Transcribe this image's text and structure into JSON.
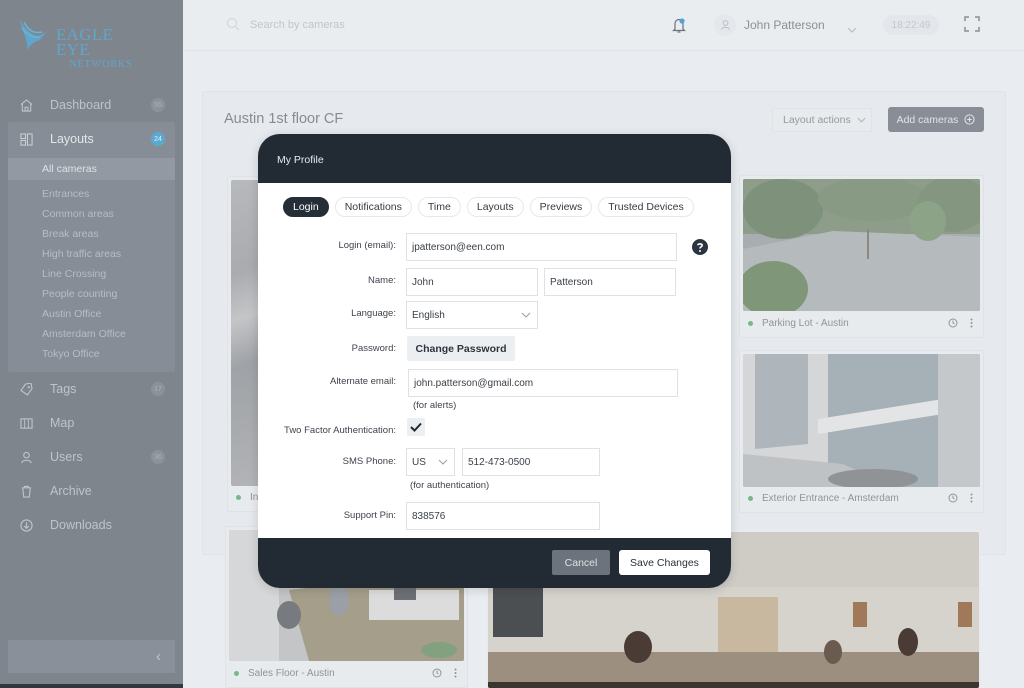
{
  "brand": {
    "name": "EAGLE EYE",
    "sub": "NETWORKS",
    "accent_color": "#5fa6cc"
  },
  "sidebar": {
    "items": [
      {
        "label": "Dashboard",
        "icon": "home-icon",
        "badge": "55"
      },
      {
        "label": "Layouts",
        "icon": "layouts-icon",
        "badge": "24"
      },
      {
        "label": "Tags",
        "icon": "tag-icon",
        "badge": "17"
      },
      {
        "label": "Map",
        "icon": "map-icon",
        "badge": ""
      },
      {
        "label": "Users",
        "icon": "user-icon",
        "badge": "36"
      },
      {
        "label": "Archive",
        "icon": "trash-icon",
        "badge": ""
      },
      {
        "label": "Downloads",
        "icon": "download-icon",
        "badge": ""
      }
    ],
    "layouts_sub": [
      "All cameras",
      "Entrances",
      "Common areas",
      "Break areas",
      "High traffic areas",
      "Line Crossing",
      "People counting",
      "Austin Office",
      "Amsterdam Office",
      "Tokyo Office"
    ],
    "collapse_icon": "‹"
  },
  "header": {
    "search_placeholder": "Search by cameras",
    "user_name": "John Patterson",
    "clock": "18:22:49"
  },
  "page": {
    "title": "Austin 1st floor CF",
    "layout_actions": "Layout actions",
    "add_cameras": "Add cameras"
  },
  "cameras": [
    {
      "name": "Int",
      "status": "online"
    },
    {
      "name": "Parking Lot - Austin",
      "status": "online"
    },
    {
      "name": "Exterior Entrance - Amsterdam",
      "status": "online"
    },
    {
      "name": "Sales Floor - Austin",
      "status": "online"
    },
    {
      "name": "",
      "status": ""
    }
  ],
  "modal": {
    "title": "My Profile",
    "tabs": [
      "Login",
      "Notifications",
      "Time",
      "Layouts",
      "Previews",
      "Trusted Devices"
    ],
    "active_tab": "Login",
    "labels": {
      "login": "Login (email):",
      "name": "Name:",
      "language": "Language:",
      "password": "Password:",
      "alt_email": "Alternate email:",
      "two_factor": "Two Factor Authentication:",
      "sms": "SMS Phone:",
      "pin": "Support Pin:"
    },
    "values": {
      "login_email": "jpatterson@een.com",
      "first_name": "John",
      "last_name": "Patterson",
      "language": "English",
      "alt_email": "john.patterson@gmail.com",
      "two_factor_enabled": true,
      "sms_country": "US",
      "sms_phone": "512-473-0500",
      "support_pin": "838576"
    },
    "hints": {
      "alt_email": "(for alerts)",
      "sms": "(for authentication)"
    },
    "change_password": "Change Password",
    "cancel": "Cancel",
    "save": "Save Changes"
  }
}
